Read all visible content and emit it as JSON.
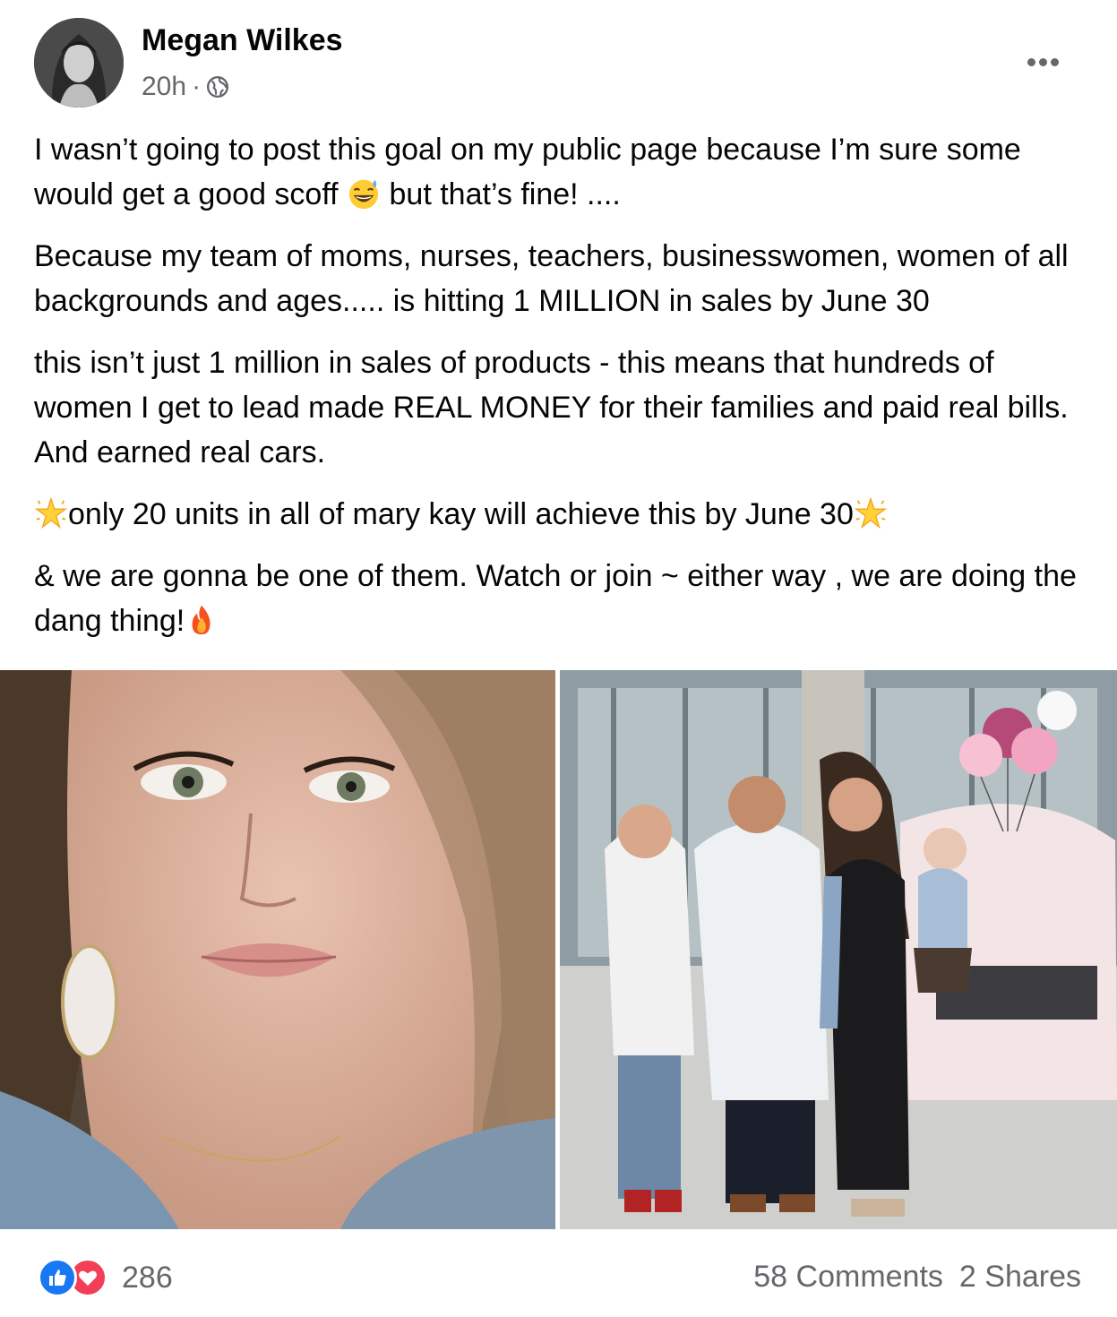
{
  "post": {
    "author": "Megan Wilkes",
    "timestamp": "20h",
    "separator": "·",
    "privacy_icon": "globe-icon",
    "more_icon": "more-options-icon",
    "paragraphs": [
      {
        "before": "I wasn’t going to post this goal on my public page because I’m sure some would get a good scoff ",
        "emoji": "grinning-sweat-emoji",
        "after": " but that’s fine! ...."
      },
      {
        "text": "Because my team of moms, nurses, teachers, businesswomen, women of all backgrounds and ages..... is hitting 1 MILLION in sales by June 30"
      },
      {
        "text": "this isn’t just 1 million in sales of products - this means that hundreds of women I get to lead made REAL MONEY for their families and paid real bills. And earned real cars."
      },
      {
        "text": "only 20 units in all of mary kay will achieve this by June 30",
        "emoji": "glowing-star-emoji"
      },
      {
        "text": "& we are gonna be one of them. Watch or join ~ either way , we are doing the dang thing!",
        "emoji": "fire-emoji"
      }
    ],
    "photos": [
      {
        "name": "selfie-photo",
        "description": "close-up selfie"
      },
      {
        "name": "family-car-photo",
        "description": "family in front of pink car"
      }
    ]
  },
  "footer": {
    "reaction_icons": [
      "like-icon",
      "love-icon"
    ],
    "reaction_count": "286",
    "comments": "58 Comments",
    "shares": "2 Shares"
  },
  "colors": {
    "text": "#050505",
    "secondary_text": "#65676b",
    "like_blue": "#1877f2",
    "love_red": "#f33e58"
  }
}
